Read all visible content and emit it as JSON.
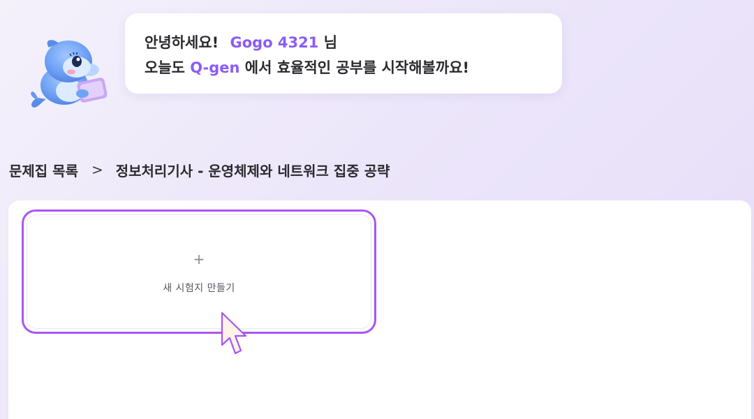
{
  "greeting": {
    "hello": "안녕하세요!",
    "user_name": "Gogo 4321",
    "honorific": "님",
    "line2_prefix": "오늘도",
    "app_name": "Q-gen",
    "line2_suffix": "에서 효율적인 공부를 시작해볼까요!"
  },
  "breadcrumb": {
    "parent": "문제집 목록",
    "separator": ">",
    "current": "정보처리기사 - 운영체제와 네트워크 집중 공략"
  },
  "new_test_card": {
    "plus": "+",
    "label": "새 시험지 만들기"
  },
  "icons": {
    "mascot": "dolphin-mascot-with-tablet",
    "cursor": "pointer-cursor"
  },
  "colors": {
    "accent": "#8b5cf6",
    "card_border": "#a855f7",
    "text_dark": "#2a2a2e",
    "text_muted": "#55555e"
  }
}
